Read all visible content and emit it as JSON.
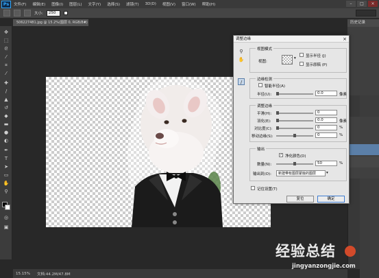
{
  "menubar": {
    "logo": "Ps",
    "items": [
      "文件(F)",
      "编辑(E)",
      "图像(I)",
      "图层(L)",
      "文字(Y)",
      "选择(S)",
      "滤镜(T)",
      "3D(D)",
      "视图(V)",
      "窗口(W)",
      "帮助(H)"
    ],
    "window_controls": [
      "–",
      "□",
      "×"
    ]
  },
  "options_bar": {
    "size_label": "大小:",
    "size_value": "250"
  },
  "document_tab": {
    "title": "506227481.jpg @ 15.2%(图层 0, RGB/8#)",
    "close": "×"
  },
  "panels": {
    "history_tab": "历史记录"
  },
  "dialog": {
    "title": "调整边缘",
    "close": "×",
    "view_mode": {
      "group_title": "视图模式",
      "view_label": "视图:",
      "show_radius": "显示半径 (J)",
      "show_original": "显示原稿 (P)"
    },
    "edge_detection": {
      "group_title": "边缘检测",
      "smart_radius": "智能半径(A)",
      "radius_label": "半径(U):",
      "radius_value": "0.0",
      "radius_unit": "像素"
    },
    "adjust_edge": {
      "group_title": "调整边缘",
      "smooth_label": "平滑(H):",
      "smooth_value": "0",
      "feather_label": "羽化(E):",
      "feather_value": "0.0",
      "feather_unit": "像素",
      "contrast_label": "对比度(C):",
      "contrast_value": "0",
      "contrast_unit": "%",
      "shift_label": "移动边缘(S):",
      "shift_value": "0",
      "shift_unit": "%"
    },
    "output": {
      "group_title": "输出",
      "decontaminate": "净化颜色(D)",
      "amount_label": "数量(N):",
      "amount_value": "50",
      "amount_unit": "%",
      "output_to_label": "输出到(O):",
      "output_to_value": "新建带有图层蒙版的图层"
    },
    "remember": "记住设置(T)",
    "cancel": "复位",
    "ok": "确定"
  },
  "statusbar": {
    "zoom": "15.15%",
    "doc_info": "文档:44.2M/47.8M"
  },
  "watermark": {
    "text": "经验总结",
    "url": "jingyanzongjie.com"
  }
}
